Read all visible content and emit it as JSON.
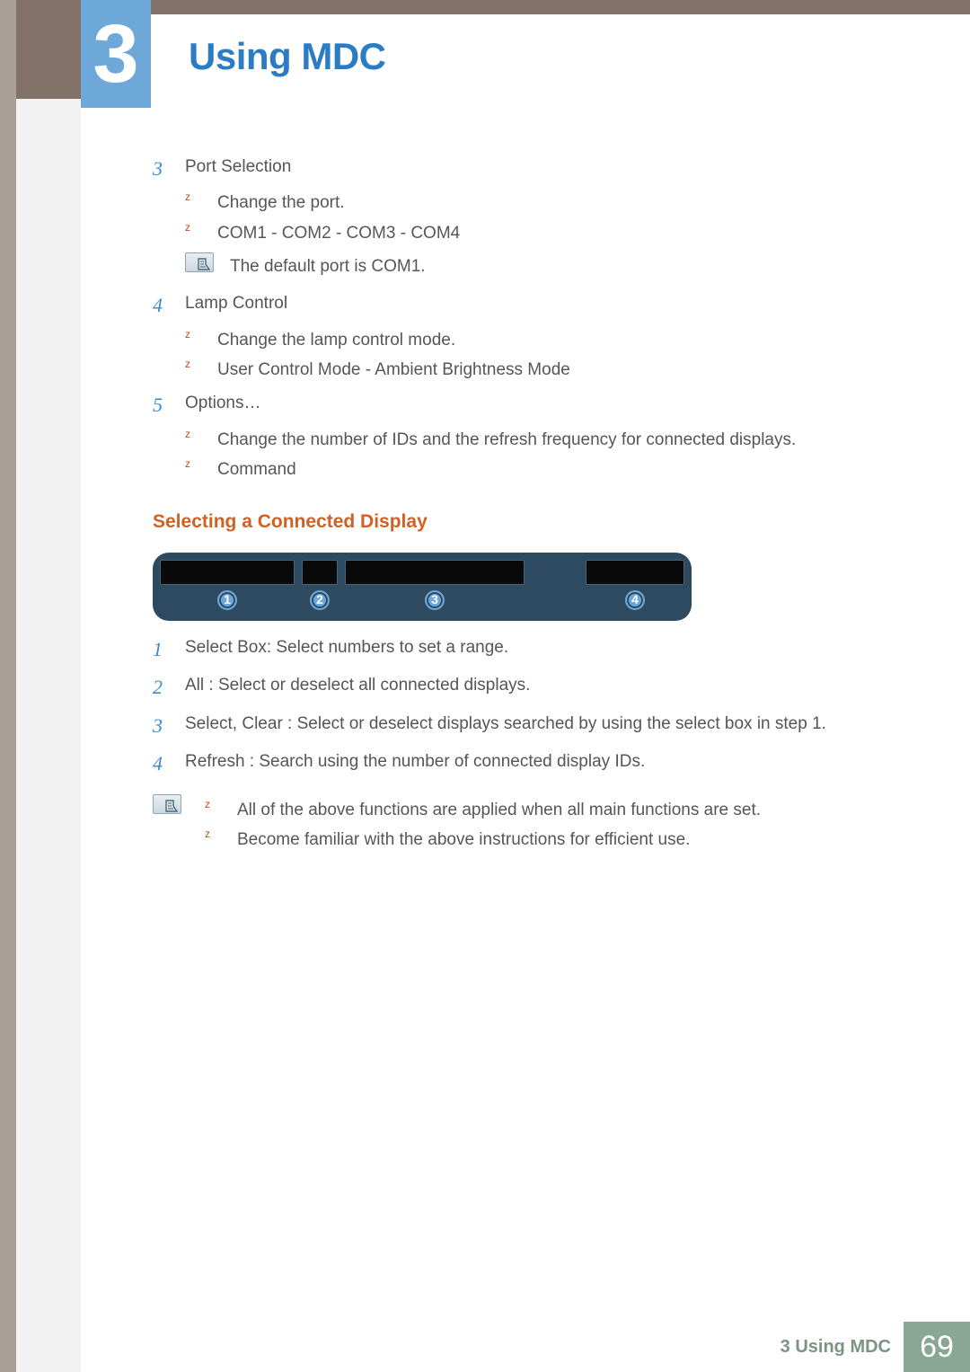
{
  "header": {
    "chapter_number": "3",
    "title": "Using MDC"
  },
  "steps_a": [
    {
      "num": "3",
      "title": "Port Selection",
      "subs": [
        "Change the port.",
        "COM1 - COM2 - COM3 - COM4"
      ],
      "note": "The default port is COM1."
    },
    {
      "num": "4",
      "title": "Lamp Control",
      "subs": [
        "Change the lamp control mode.",
        "User Control Mode - Ambient Brightness Mode"
      ]
    },
    {
      "num": "5",
      "title": "Options…",
      "subs": [
        "Change the number of IDs and the refresh frequency for connected displays.",
        "Command"
      ]
    }
  ],
  "section_heading": "Selecting a Connected Display",
  "diagram_labels": [
    "1",
    "2",
    "3",
    "4"
  ],
  "steps_b": [
    {
      "num": "1",
      "text": "Select Box: Select numbers to set a range."
    },
    {
      "num": "2",
      "text": "All : Select or deselect all connected displays."
    },
    {
      "num": "3",
      "text": "Select, Clear : Select or deselect displays searched by using the select box in step 1."
    },
    {
      "num": "4",
      "text": "Refresh : Search using the number of connected display IDs."
    }
  ],
  "bottom_note_subs": [
    "All of the above functions are applied when all main functions are set.",
    "Become familiar with the above instructions for efficient use."
  ],
  "footer": {
    "crumb": "3 Using MDC",
    "page_number": "69"
  }
}
